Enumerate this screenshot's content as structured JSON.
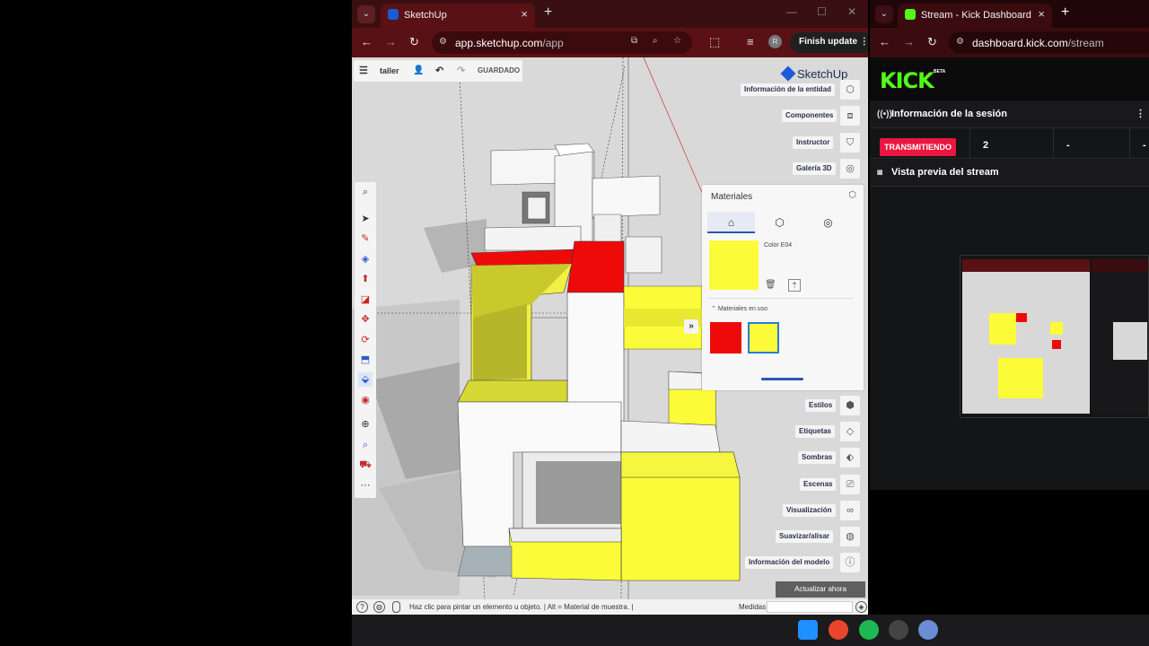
{
  "left_browser": {
    "tab_title": "SketchUp",
    "url_host": "app.sketchup.com",
    "url_path": "/app",
    "profile_initial": "R",
    "finish_update_label": "Finish update"
  },
  "sketchup": {
    "project_name": "taller",
    "save_state": "GUARDADO",
    "logo_text": "SketchUp",
    "right_panel": {
      "entity_info": "Información de la entidad",
      "components": "Componentes",
      "instructor": "Instructor",
      "gallery_3d": "Galería 3D",
      "styles": "Estilos",
      "tags": "Etiquetas",
      "shadows": "Sombras",
      "scenes": "Escenas",
      "visualization": "Visualización",
      "soften": "Suavizar/alisar",
      "model_info": "Información del modelo"
    },
    "materials": {
      "title": "Materiales",
      "selected_color_name": "Color E04",
      "in_use_label": "Materiales en uso",
      "in_use_colors": [
        "#ef0a0a",
        "#fbfb3a"
      ]
    },
    "update_now": "Actualizar ahora",
    "status_hint": "Haz clic para pintar un elemento u objeto. | Alt = Material de muestra. |",
    "measurements_label": "Medidas"
  },
  "right_browser": {
    "tab_title": "Stream - Kick Dashboard",
    "url_host": "dashboard.kick.com",
    "url_path": "/stream",
    "logo_text": "KICK",
    "beta_label": "BETA",
    "session_info_title": "Información de la sesión",
    "live_status": "TRANSMITIENDO",
    "stat_values": [
      "2",
      "-",
      "-"
    ],
    "stream_preview_title": "Vista previa del stream"
  },
  "colors": {
    "yellow": "#fbfb3a",
    "red": "#ef0a0a",
    "kick_green": "#53fc18",
    "live_red": "#e9163f"
  }
}
